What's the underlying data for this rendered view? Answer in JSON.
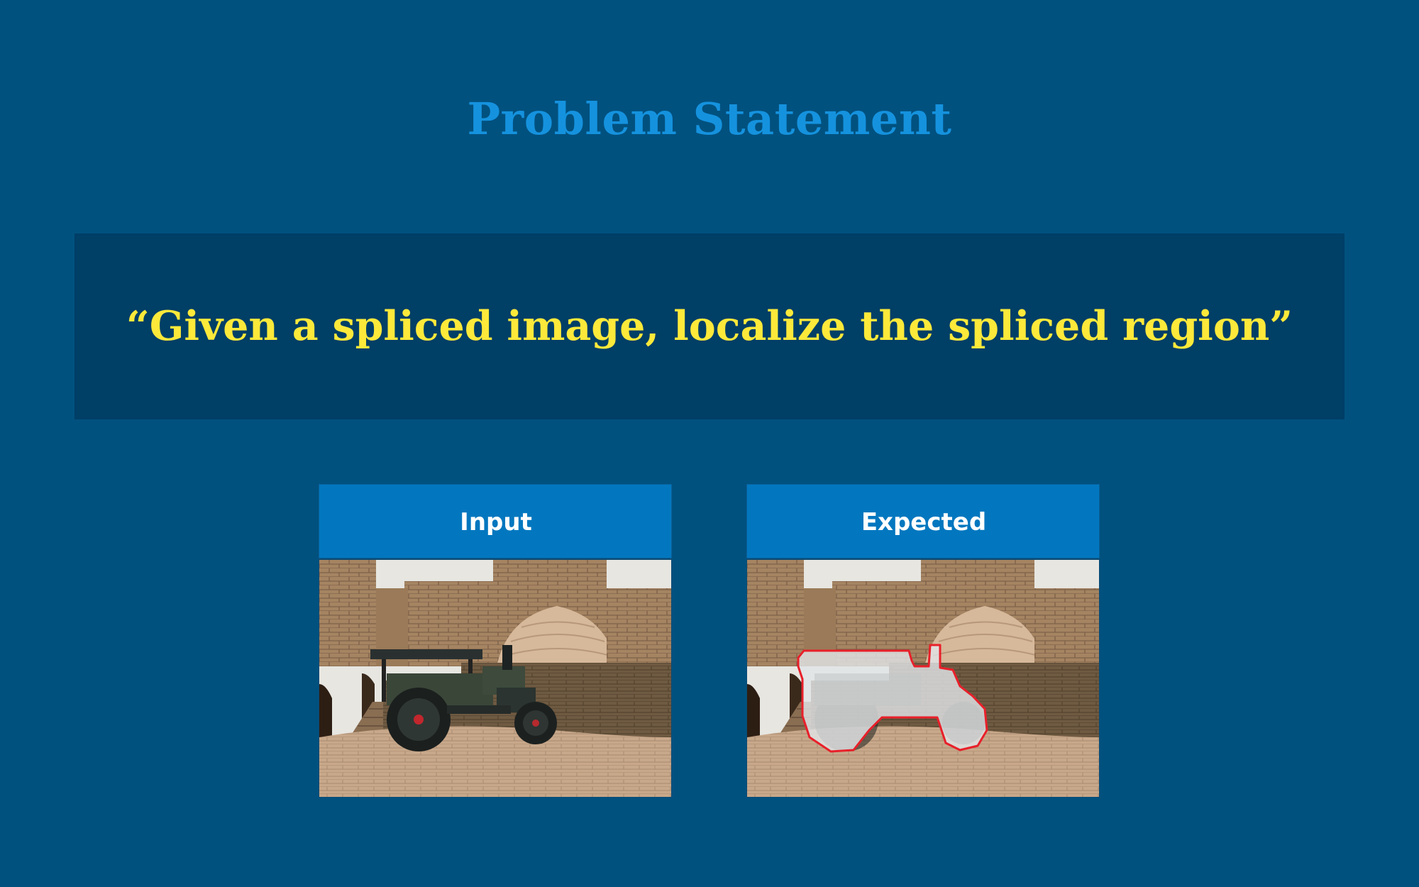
{
  "title": "Problem Statement",
  "quote": "“Given a spliced image, localize the spliced region”",
  "panels": [
    {
      "label": "Input",
      "image": "spliced-image-steamroller-in-courtyard"
    },
    {
      "label": "Expected",
      "image": "spliced-region-mask-overlay"
    }
  ],
  "colors": {
    "background": "#01517f",
    "title": "#1592de",
    "quote_band": "#003f66",
    "quote_text": "#fde93a",
    "panel_header": "#0277bf",
    "mask_outline": "#e8202a"
  }
}
